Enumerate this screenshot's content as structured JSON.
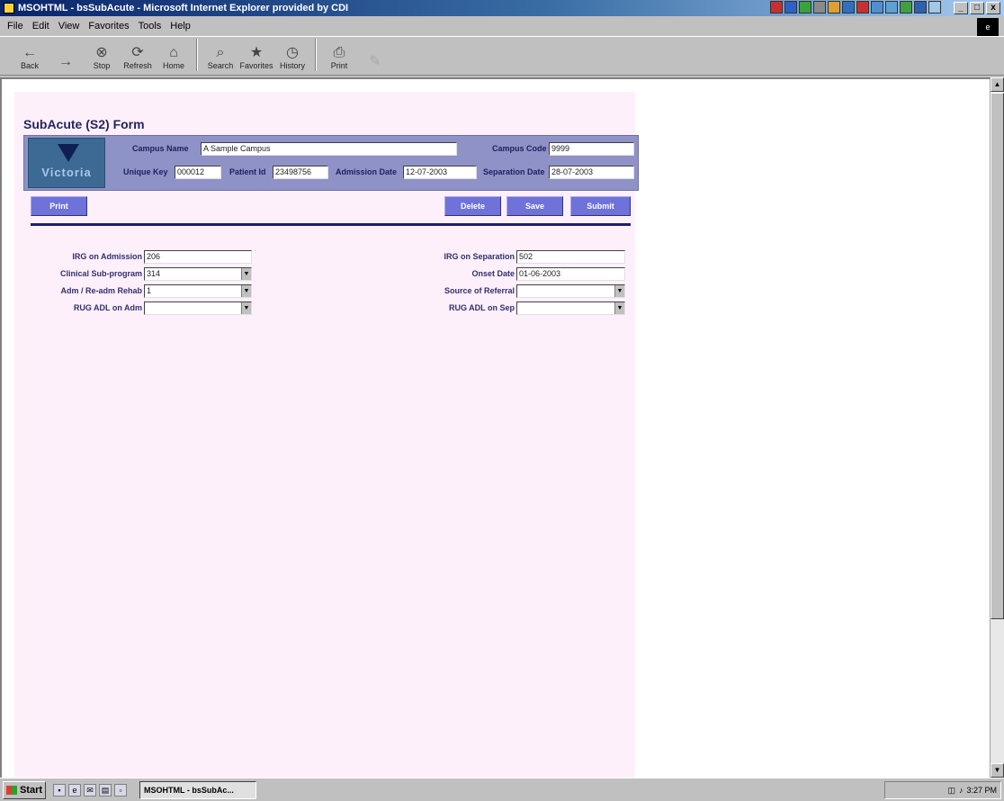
{
  "window": {
    "title": "MSOHTML - bsSubAcute - Microsoft Internet Explorer provided by CDI",
    "min": "_",
    "max": "□",
    "close": "x"
  },
  "menu": [
    "File",
    "Edit",
    "View",
    "Favorites",
    "Tools",
    "Help"
  ],
  "toolbar": [
    {
      "label": "Back",
      "icon": "back-arrow-icon",
      "glyph": "←"
    },
    {
      "label": "",
      "icon": "forward-arrow-icon",
      "glyph": "→"
    },
    {
      "label": "Stop",
      "icon": "stop-icon",
      "glyph": "⊗"
    },
    {
      "label": "Refresh",
      "icon": "refresh-icon",
      "glyph": "⟳"
    },
    {
      "label": "Home",
      "icon": "home-icon",
      "glyph": "⌂"
    },
    {
      "label": "Search",
      "icon": "search-icon",
      "glyph": "⌕"
    },
    {
      "label": "Favorites",
      "icon": "favorites-icon",
      "glyph": "★"
    },
    {
      "label": "History",
      "icon": "history-icon",
      "glyph": "◷"
    },
    {
      "label": "Print",
      "icon": "print-icon",
      "glyph": "⎙"
    },
    {
      "label": "",
      "icon": "edit-icon",
      "glyph": "✎"
    }
  ],
  "form": {
    "title": "SubAcute (S2) Form",
    "logo_text": "Victoria",
    "header": {
      "campus_name_label": "Campus Name",
      "campus_name_value": "A Sample Campus",
      "campus_code_label": "Campus Code",
      "campus_code_value": "9999",
      "unique_key_label": "Unique Key",
      "unique_key_value": "000012",
      "patient_id_label": "Patient Id",
      "patient_id_value": "23498756",
      "admission_date_label": "Admission Date",
      "admission_date_value": "12-07-2003",
      "separation_date_label": "Separation Date",
      "separation_date_value": "28-07-2003"
    },
    "buttons": {
      "print": "Print",
      "delete": "Delete",
      "save": "Save",
      "submit": "Submit"
    },
    "left_fields": {
      "irg_admission_label": "IRG on Admission",
      "irg_admission_value": "206",
      "clinical_subprogram_label": "Clinical Sub-program",
      "clinical_subprogram_value": "314",
      "admin_readmin_label": "Adm / Re-adm Rehab",
      "admin_readmin_value": "1",
      "rug_adl_admin_label": "RUG ADL on Adm",
      "rug_adl_admin_value": ""
    },
    "right_fields": {
      "irg_separation_label": "IRG on Separation",
      "irg_separation_value": "502",
      "onset_date_label": "Onset Date",
      "onset_date_value": "01-06-2003",
      "source_referral_label": "Source of Referral",
      "source_referral_value": "",
      "rug_adl_sep_label": "RUG ADL on Sep",
      "rug_adl_sep_value": ""
    }
  },
  "taskbar": {
    "start": "Start",
    "task_item": "MSOHTML - bsSubAc...",
    "clock": "3:27 PM"
  }
}
